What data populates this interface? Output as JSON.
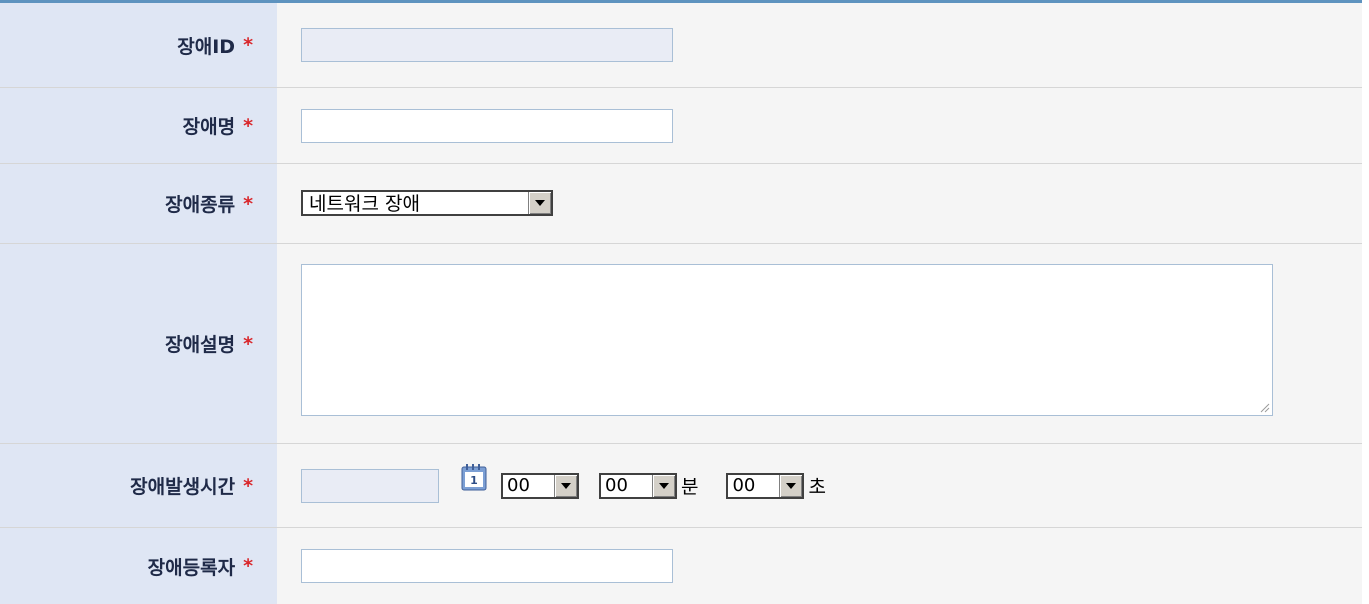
{
  "form": {
    "rows": [
      {
        "label": "장애ID",
        "required": "*"
      },
      {
        "label": "장애명",
        "required": "*"
      },
      {
        "label": "장애종류",
        "required": "*"
      },
      {
        "label": "장애설명",
        "required": "*"
      },
      {
        "label": "장애발생시간",
        "required": "*"
      },
      {
        "label": "장애등록자",
        "required": "*"
      }
    ],
    "fault_id": {
      "value": ""
    },
    "fault_name": {
      "value": ""
    },
    "fault_type": {
      "selected": "네트워크 장애"
    },
    "fault_desc": {
      "value": ""
    },
    "fault_time": {
      "date": "",
      "hour": "00",
      "minute": "00",
      "minute_unit": "분",
      "second": "00",
      "second_unit": "초"
    },
    "fault_registrant": {
      "value": ""
    }
  },
  "colors": {
    "top_border": "#5e93bf",
    "label_bg": "#dfe6f4",
    "value_bg": "#f5f5f5",
    "required_star": "#d9262a",
    "label_text": "#1f2a48"
  },
  "icons": {
    "calendar": "calendar-icon",
    "dropdown": "chevron-down-icon",
    "resize": "resize-grip-icon"
  }
}
